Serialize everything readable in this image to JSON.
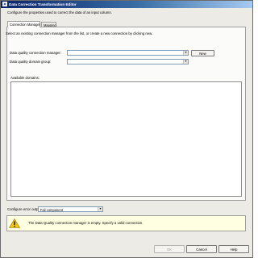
{
  "window": {
    "title": "Data Correction Transformation Editor",
    "icon": "app-icon"
  },
  "description": "Configure the properties used to correct the data of an input column.",
  "tabs": [
    {
      "label": "Connection Manager",
      "active": true
    },
    {
      "label": "Mapping",
      "active": false
    }
  ],
  "connection_manager": {
    "instructions": "Select an existing connection manager from the list, or create a new connection by clicking new.",
    "dq_connection_label": "Data quality connection manager:",
    "dq_connection_value": "",
    "new_button": "New",
    "dq_domain_group_label": "Data quality domain group:",
    "dq_domain_group_value": "",
    "available_domains_label": "Available domains:"
  },
  "error_output": {
    "label": "Configure error output:",
    "value": "Fail component"
  },
  "message": {
    "icon": "warning-icon",
    "text": "The Data Quality connection manager is empty. Specify a valid connection."
  },
  "buttons": {
    "ok": "OK",
    "cancel": "Cancel",
    "help": "Help"
  },
  "colors": {
    "title_bar": "#0a246a",
    "message_bg": "#ffffe1",
    "warning": "#f2c811"
  }
}
